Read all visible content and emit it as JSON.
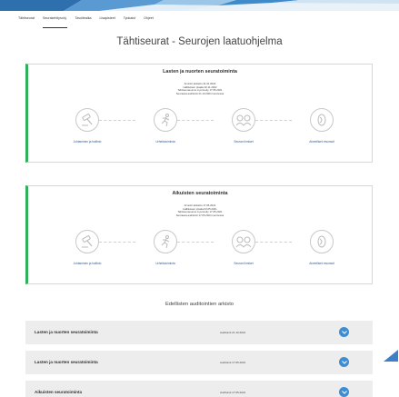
{
  "nav": {
    "items": [
      {
        "label": "Tähtiseurat",
        "active": false
      },
      {
        "label": "Seurakehitysohj.",
        "active": true
      },
      {
        "label": "Tavoiteaika",
        "active": false
      },
      {
        "label": "Lisapisteet",
        "active": false
      },
      {
        "label": "Tyokalut",
        "active": false
      },
      {
        "label": "Ohjeet",
        "active": false
      }
    ]
  },
  "page": {
    "title": "Tähtiseurat - Seurojen laatuohjelma"
  },
  "programs": [
    {
      "title": "Lasten ja nuorten seuratoiminta",
      "meta": [
        "Arvioint aloitettu 31.01.2022",
        "Hallituksen pisaka 02.11.2022",
        "Tahtiseuraounus myonnetty 17.05.2021",
        "Seuraava auditointi 21.10.2024 mennessa"
      ],
      "steps": [
        {
          "label": "Johtaminen ja hallinto",
          "icon": "gavel-icon"
        },
        {
          "label": "Urheilutoiminta",
          "icon": "runner-icon"
        },
        {
          "label": "Seuran ihmiset",
          "icon": "people-icon"
        },
        {
          "label": "Aineelliset resurssit",
          "icon": "coin-icon"
        }
      ]
    },
    {
      "title": "Aikuisten seuratoiminta",
      "meta": [
        "Arvioint aloitettu 17.05.2021",
        "Hallituksen pisaka 02.05.2021",
        "Tahtiseuraounus myonnetty 17.05.2021",
        "Seuraava auditointi 17.05.2024 mennessa"
      ],
      "steps": [
        {
          "label": "Johtaminen ja hallinto",
          "icon": "gavel-icon"
        },
        {
          "label": "Urheilutoiminta",
          "icon": "runner-icon"
        },
        {
          "label": "Seuran ihmiset",
          "icon": "people-icon"
        },
        {
          "label": "Aineelliset resurssit",
          "icon": "coin-icon"
        }
      ]
    }
  ],
  "archive": {
    "title": "Edellisten auditointien arkisto",
    "rows": [
      {
        "name": "Lasten ja nuorten seuratoiminta",
        "date": "Auditointi 21.10.2021"
      },
      {
        "name": "Lasten ja nuorten seuratoiminta",
        "date": "Auditointi 17.05.2021"
      },
      {
        "name": "Aikuisten seuratoiminta",
        "date": "Auditointi 17.05.2021"
      }
    ]
  },
  "colors": {
    "accent_green": "#2fb15a",
    "link_blue": "#2a5d9a",
    "toggle_blue": "#3e8dd3",
    "banner_blue": "#3f8ac9"
  }
}
